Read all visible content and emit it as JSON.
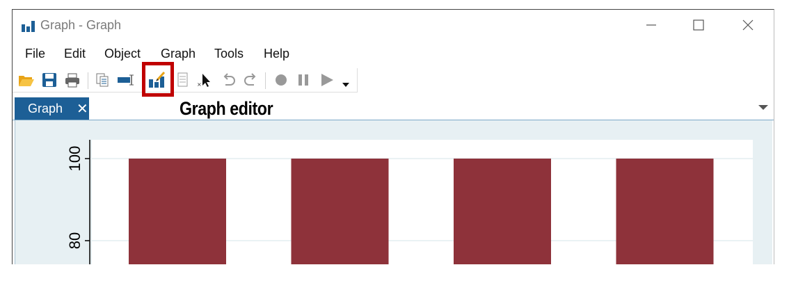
{
  "window": {
    "title": "Graph - Graph"
  },
  "menu": [
    "File",
    "Edit",
    "Object",
    "Graph",
    "Tools",
    "Help"
  ],
  "toolbar": {
    "buttons": [
      "open-icon",
      "save-icon",
      "print-icon",
      "copy-icon",
      "rename-icon",
      "graph-editor-icon",
      "data-editor-icon",
      "pointer-icon",
      "undo-icon",
      "redo-icon",
      "record-icon",
      "pause-icon",
      "play-icon",
      "dropdown-icon"
    ]
  },
  "tab": {
    "label": "Graph",
    "close": "✕"
  },
  "annotation": {
    "text": "Graph editor"
  },
  "colors": {
    "bar": "#8e323a",
    "tab": "#1d5f96",
    "highlight": "#c00000",
    "plot_bg": "#e7f0f3"
  },
  "chart_data": {
    "type": "bar",
    "categories": [
      "",
      "",
      "",
      ""
    ],
    "values": [
      100,
      100,
      100,
      100
    ],
    "yticks": [
      "100",
      "80"
    ]
  }
}
